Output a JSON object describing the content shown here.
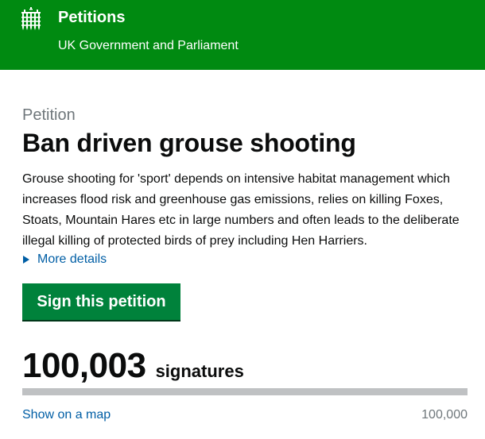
{
  "header": {
    "site_name": "Petitions",
    "subtitle": "UK Government and Parliament",
    "logo_icon": "portcullis-icon",
    "background": "#008a11"
  },
  "petition": {
    "caption": "Petition",
    "title": "Ban driven grouse shooting",
    "summary": "Grouse shooting for 'sport' depends on intensive habitat management which increases flood risk and greenhouse gas emissions, relies on killing Foxes, Stoats, Mountain Hares etc in large numbers and often leads to the deliberate illegal killing of protected birds of prey including Hen Harriers.",
    "more_details": "More details",
    "sign_button": "Sign this petition",
    "sign_button_color": "#00823b"
  },
  "signatures": {
    "count": "100,003",
    "label": "signatures",
    "progress_fraction": 1.0,
    "show_map_link": "Show on a map",
    "threshold": "100,000"
  }
}
